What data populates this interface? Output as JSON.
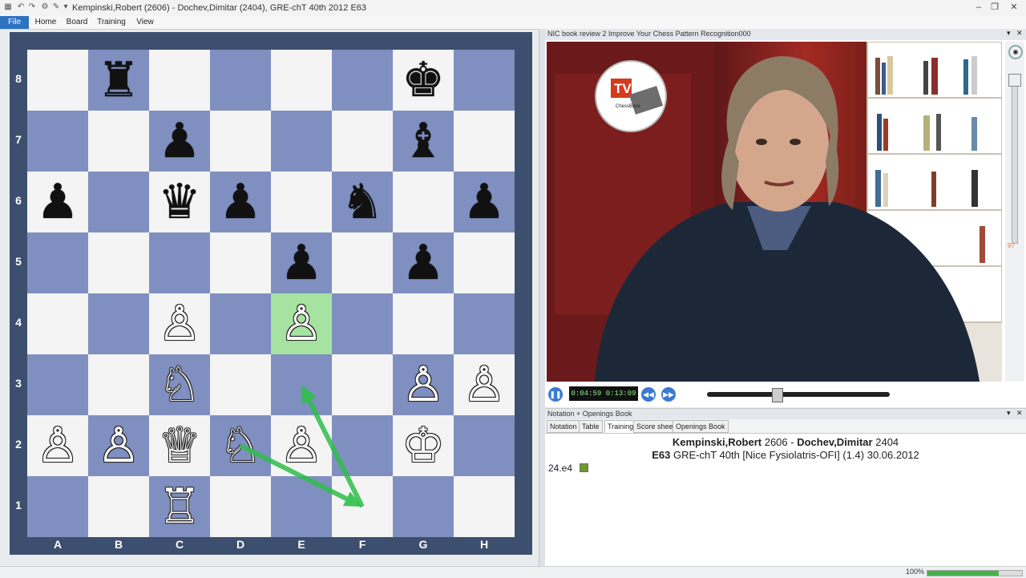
{
  "window": {
    "title": "Kempinski,Robert (2606) - Dochev,Dimitar (2404), GRE-chT 40th 2012  E63"
  },
  "ribbon": {
    "tabs": [
      "File",
      "Home",
      "Board",
      "Training",
      "View"
    ]
  },
  "board": {
    "files": [
      "A",
      "B",
      "C",
      "D",
      "E",
      "F",
      "G",
      "H"
    ],
    "ranks": [
      "8",
      "7",
      "6",
      "5",
      "4",
      "3",
      "2",
      "1"
    ],
    "highlight": "e4",
    "pieces": [
      {
        "sq": "b8",
        "glyph": "♜",
        "color": "b"
      },
      {
        "sq": "g8",
        "glyph": "♚",
        "color": "b"
      },
      {
        "sq": "c7",
        "glyph": "♟",
        "color": "b"
      },
      {
        "sq": "g7",
        "glyph": "♝",
        "color": "b"
      },
      {
        "sq": "a6",
        "glyph": "♟",
        "color": "b"
      },
      {
        "sq": "c6",
        "glyph": "♛",
        "color": "b"
      },
      {
        "sq": "d6",
        "glyph": "♟",
        "color": "b"
      },
      {
        "sq": "f6",
        "glyph": "♞",
        "color": "b"
      },
      {
        "sq": "h6",
        "glyph": "♟",
        "color": "b"
      },
      {
        "sq": "e5",
        "glyph": "♟",
        "color": "b"
      },
      {
        "sq": "g5",
        "glyph": "♟",
        "color": "b"
      },
      {
        "sq": "c4",
        "glyph": "♙",
        "color": "w"
      },
      {
        "sq": "e4",
        "glyph": "♙",
        "color": "w"
      },
      {
        "sq": "c3",
        "glyph": "♘",
        "color": "w"
      },
      {
        "sq": "g3",
        "glyph": "♙",
        "color": "w"
      },
      {
        "sq": "h3",
        "glyph": "♙",
        "color": "w"
      },
      {
        "sq": "a2",
        "glyph": "♙",
        "color": "w"
      },
      {
        "sq": "b2",
        "glyph": "♙",
        "color": "w"
      },
      {
        "sq": "c2",
        "glyph": "♕",
        "color": "w"
      },
      {
        "sq": "d2",
        "glyph": "♘",
        "color": "w"
      },
      {
        "sq": "e2",
        "glyph": "♙",
        "color": "w"
      },
      {
        "sq": "g2",
        "glyph": "♔",
        "color": "w"
      },
      {
        "sq": "c1",
        "glyph": "♖",
        "color": "w"
      }
    ],
    "arrows": [
      {
        "from": "d2",
        "to": "f1"
      },
      {
        "from": "f1",
        "to": "e3"
      }
    ],
    "arrow_color": "#2fbf4a"
  },
  "video": {
    "title": "NIC book review 2 Improve Your Chess Pattern Recognition000",
    "timecode": "0:04:59 0:13:09",
    "side_value": "97",
    "progress": 0.38,
    "logo_text": "TV",
    "logo_sub": "ChessBase"
  },
  "notation": {
    "panel_title": "Notation + Openings Book",
    "tabs": [
      "Notation",
      "Table",
      "Training",
      "Score sheet",
      "Openings Book"
    ],
    "active_tab": "Training",
    "white_name": "Kempinski,Robert",
    "white_elo": "2606",
    "black_name": "Dochev,Dimitar",
    "black_elo": "2404",
    "eco": "E63",
    "event": "GRE-chT 40th [Nice Fysiolatris-OFI] (1.4) 30.06.2012",
    "move": "24.e4"
  },
  "status": {
    "zoom": "100%",
    "zoom_fraction": 0.75
  }
}
